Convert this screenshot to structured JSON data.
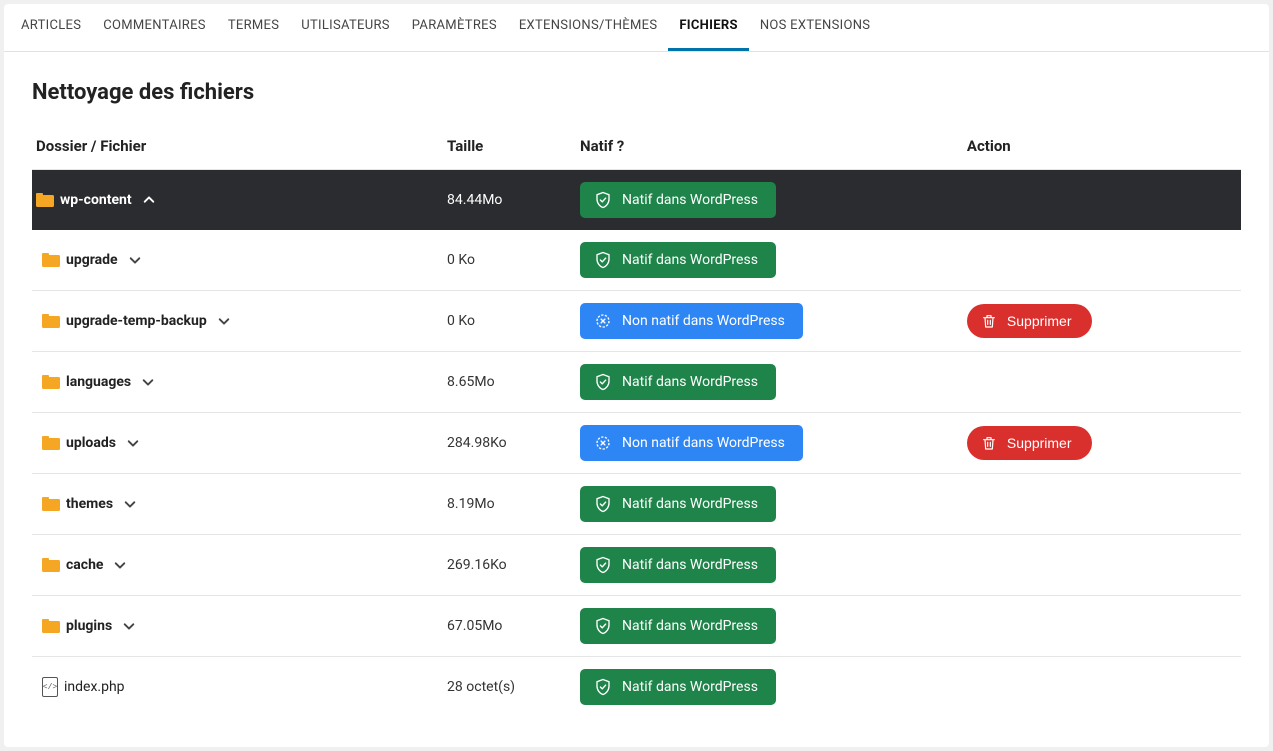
{
  "tabs": [
    {
      "label": "ARTICLES",
      "active": false
    },
    {
      "label": "COMMENTAIRES",
      "active": false
    },
    {
      "label": "TERMES",
      "active": false
    },
    {
      "label": "UTILISATEURS",
      "active": false
    },
    {
      "label": "PARAMÈTRES",
      "active": false
    },
    {
      "label": "EXTENSIONS/THÈMES",
      "active": false
    },
    {
      "label": "FICHIERS",
      "active": true
    },
    {
      "label": "NOS EXTENSIONS",
      "active": false
    }
  ],
  "page_title": "Nettoyage des fichiers",
  "headers": {
    "name": "Dossier / Fichier",
    "size": "Taille",
    "native": "Natif ?",
    "action": "Action"
  },
  "labels": {
    "native": "Natif dans WordPress",
    "nonnative": "Non natif dans WordPress",
    "delete": "Supprimer"
  },
  "rows": [
    {
      "name": "wp-content",
      "type": "folder",
      "depth": 0,
      "expanded": true,
      "size": "84.44Mo",
      "native": true,
      "deletable": false
    },
    {
      "name": "upgrade",
      "type": "folder",
      "depth": 1,
      "expanded": false,
      "size": "0 Ko",
      "native": true,
      "deletable": false
    },
    {
      "name": "upgrade-temp-backup",
      "type": "folder",
      "depth": 1,
      "expanded": false,
      "size": "0 Ko",
      "native": false,
      "deletable": true
    },
    {
      "name": "languages",
      "type": "folder",
      "depth": 1,
      "expanded": false,
      "size": "8.65Mo",
      "native": true,
      "deletable": false
    },
    {
      "name": "uploads",
      "type": "folder",
      "depth": 1,
      "expanded": false,
      "size": "284.98Ko",
      "native": false,
      "deletable": true
    },
    {
      "name": "themes",
      "type": "folder",
      "depth": 1,
      "expanded": false,
      "size": "8.19Mo",
      "native": true,
      "deletable": false
    },
    {
      "name": "cache",
      "type": "folder",
      "depth": 1,
      "expanded": false,
      "size": "269.16Ko",
      "native": true,
      "deletable": false
    },
    {
      "name": "plugins",
      "type": "folder",
      "depth": 1,
      "expanded": false,
      "size": "67.05Mo",
      "native": true,
      "deletable": false
    },
    {
      "name": "index.php",
      "type": "file",
      "depth": 1,
      "expanded": null,
      "size": "28 octet(s)",
      "native": true,
      "deletable": false
    }
  ]
}
